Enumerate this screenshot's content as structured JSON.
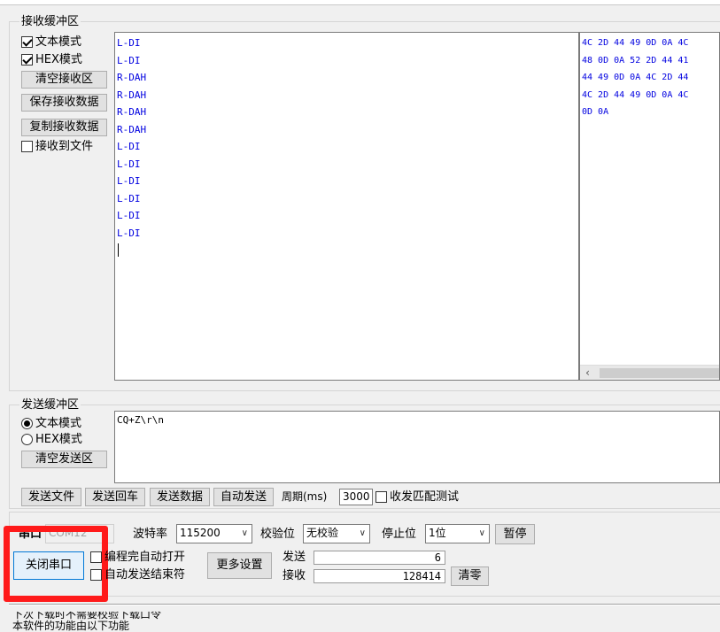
{
  "receive": {
    "title": "接收缓冲区",
    "text_mode_label": "文本模式",
    "hex_mode_label": "HEX模式",
    "clear_label": "清空接收区",
    "save_label": "保存接收数据",
    "copy_label": "复制接收数据",
    "to_file_label": "接收到文件",
    "text_lines": [
      "L-DI",
      "L-DI",
      "R-DAH",
      "R-DAH",
      "R-DAH",
      "R-DAH",
      "L-DI",
      "L-DI",
      "L-DI",
      "L-DI",
      "L-DI",
      "L-DI"
    ],
    "hex_lines": [
      "4C 2D 44 49 0D 0A 4C",
      "48 0D 0A 52 2D 44 41",
      "44 49 0D 0A 4C 2D 44",
      "4C 2D 44 49 0D 0A 4C",
      "0D 0A"
    ]
  },
  "send": {
    "title": "发送缓冲区",
    "text_mode_label": "文本模式",
    "hex_mode_label": "HEX模式",
    "clear_label": "清空发送区",
    "content": "CQ+Z\\r\\n",
    "send_file_label": "发送文件",
    "send_enter_label": "发送回车",
    "send_data_label": "发送数据",
    "auto_send_label": "自动发送",
    "period_label": "周期(ms)",
    "period_value": "3000",
    "match_test_label": "收发匹配测试"
  },
  "serial": {
    "port_label": "串口",
    "port_value": "COM12",
    "baud_label": "波特率",
    "baud_value": "115200",
    "parity_label": "校验位",
    "parity_value": "无校验",
    "stop_label": "停止位",
    "stop_value": "1位",
    "pause_label": "暂停",
    "close_label": "关闭串口",
    "auto_open_label": "编程完自动打开",
    "auto_send_end_label": "自动发送结束符",
    "more_settings_label": "更多设置",
    "sent_label": "发送",
    "sent_value": "6",
    "recv_label": "接收",
    "recv_value": "128414",
    "clear_count_label": "清零"
  },
  "bottom_text": {
    "line1": "下次下载时不需要校验下载口令",
    "line2": "本软件的功能由以下功能"
  },
  "colors": {
    "highlight": "#ff1a1a",
    "data_text": "#0000e0"
  }
}
